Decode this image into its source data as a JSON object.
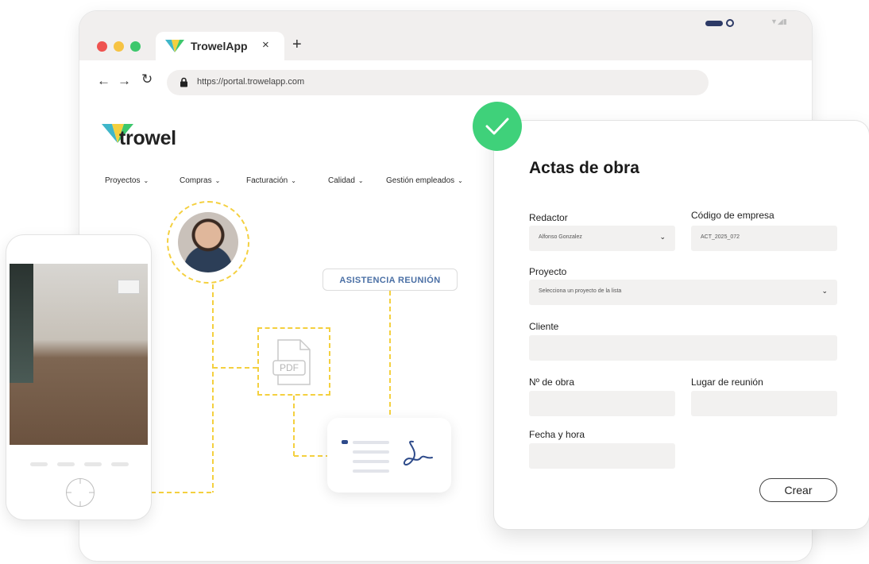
{
  "browser": {
    "tab_title": "TrowelApp",
    "tab_close": "×",
    "tab_new": "+",
    "url": "https://portal.trowelapp.com",
    "nav_back": "←",
    "nav_forward": "→",
    "nav_reload": "↻"
  },
  "brand": {
    "name": "trowel"
  },
  "menu": {
    "items": [
      "Proyectos",
      "Compras",
      "Facturación",
      "Calidad",
      "Gestión empleados"
    ]
  },
  "illustration": {
    "badge": "ASISTENCIA REUNIÓN",
    "pdf_label": "PDF"
  },
  "form": {
    "title": "Actas de obra",
    "redactor_label": "Redactor",
    "redactor_value": "Alfonso Gonzalez",
    "codigo_label": "Código de empresa",
    "codigo_value": "ACT_2025_072",
    "proyecto_label": "Proyecto",
    "proyecto_placeholder": "Selecciona un proyecto de la lista",
    "cliente_label": "Cliente",
    "nobra_label": "Nº de obra",
    "lugar_label": "Lugar de reunión",
    "fecha_label": "Fecha y hora",
    "submit_label": "Crear"
  },
  "colors": {
    "accent_yellow": "#f4d03f",
    "check_green": "#3fd17a",
    "badge_blue": "#4a6fa5"
  }
}
